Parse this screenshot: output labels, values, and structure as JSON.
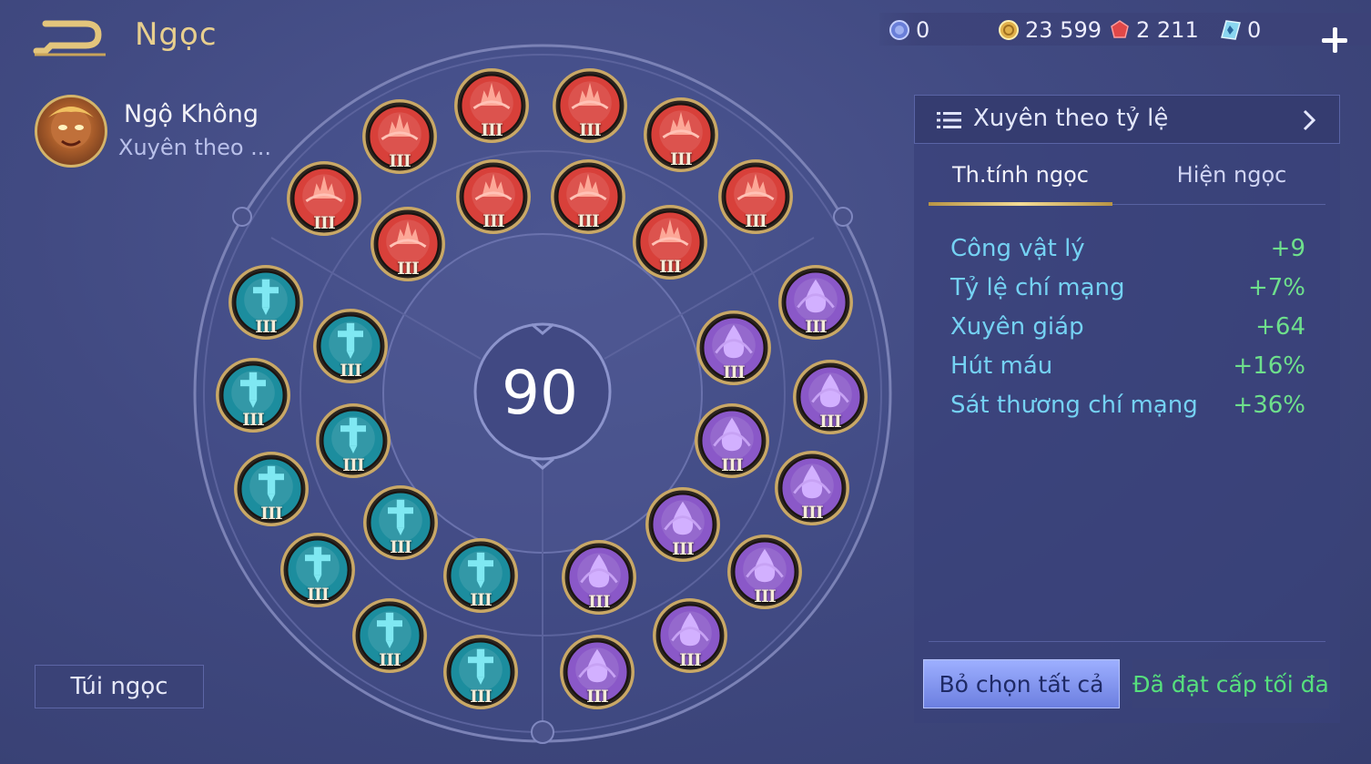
{
  "header": {
    "title": "Ngọc"
  },
  "hero": {
    "name": "Ngộ Không",
    "set_name": "Xuyên theo ..."
  },
  "currencies": [
    {
      "icon": "blue-coin-icon",
      "value": "0"
    },
    {
      "icon": "gold-coin-icon",
      "value": "23 599"
    },
    {
      "icon": "red-gem-icon",
      "value": "2 211"
    },
    {
      "icon": "diamond-card-icon",
      "value": "0"
    }
  ],
  "wheel": {
    "total_level": "90"
  },
  "gems": {
    "red": {
      "count": 10,
      "tier": "III",
      "color": "#d8403a"
    },
    "teal": {
      "count": 10,
      "tier": "III",
      "color": "#1c8d9e"
    },
    "purple": {
      "count": 10,
      "tier": "III",
      "color": "#8a58c8"
    }
  },
  "bag_button": "Túi ngọc",
  "panel": {
    "set_selector": "Xuyên theo tỷ lệ",
    "tabs": {
      "attributes": "Th.tính ngọc",
      "show": "Hiện ngọc"
    },
    "stats": [
      {
        "name": "Công vật lý",
        "value": "+9"
      },
      {
        "name": "Tỷ lệ chí mạng",
        "value": "+7%"
      },
      {
        "name": "Xuyên giáp",
        "value": "+64"
      },
      {
        "name": "Hút máu",
        "value": "+16%"
      },
      {
        "name": "Sát thương chí mạng",
        "value": "+36%"
      }
    ],
    "clear_button": "Bỏ chọn tất cả",
    "max_level_label": "Đã đạt cấp tối đa"
  },
  "colors": {
    "accent_gold": "#e8cf8e",
    "stat_name": "#75d2f3",
    "stat_value": "#6ee08c"
  }
}
